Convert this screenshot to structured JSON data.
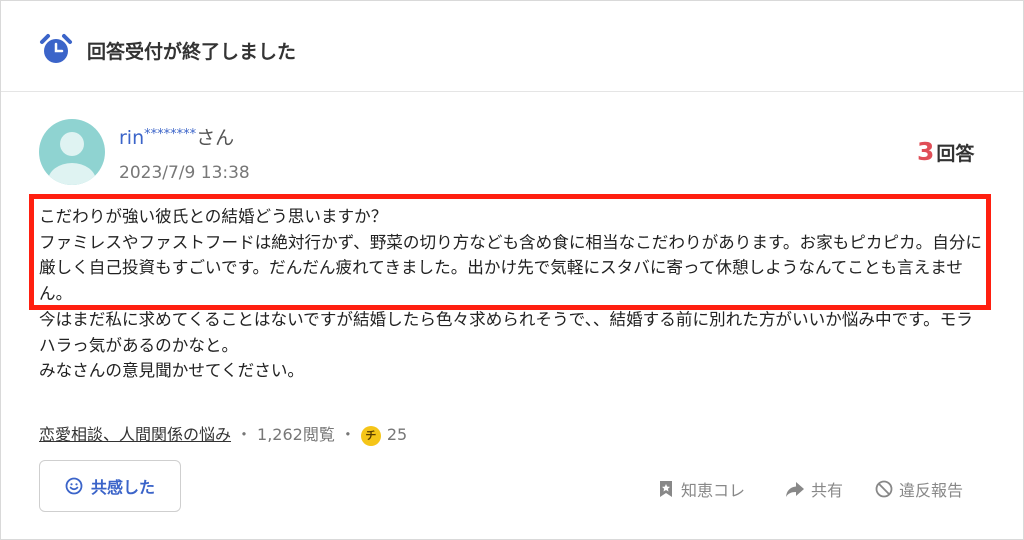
{
  "header": {
    "title": "回答受付が終了しました",
    "icon": "alarm-clock-icon"
  },
  "question": {
    "username": "rin",
    "username_mask": "********",
    "honorific": "さん",
    "posted_at": "2023/7/9 13:38",
    "answer_count": "3",
    "answer_label": "回答",
    "body_lines": [
      "こだわりが強い彼氏との結婚どう思いますか？",
      "ファミレスやファストフードは絶対行かず、野菜の切り方なども含め食に相当なこだわりがあります。お家もピカピカ。自分に厳しく自己投資もすごいです。だんだん疲れてきました。出かけ先で気軽にスタバに寄って休憩しようなんてことも言えません。",
      "今はまだ私に求めてくることはないですが結婚したら色々求められそうで、、結婚する前に別れた方がいいか悩み中です。モラハラっ気があるのかなと。",
      "みなさんの意見聞かせてください。"
    ]
  },
  "meta": {
    "category": "恋愛相談、人間関係の悩み",
    "separator": "・",
    "views": "1,262閲覧",
    "coin_symbol": "チ",
    "coins": "25"
  },
  "buttons": {
    "empathy": "共感した",
    "chie_kore": "知恵コレ",
    "share": "共有",
    "report": "違反報告"
  },
  "colors": {
    "accent_blue": "#3b64c9",
    "answer_count_red": "#e04e57",
    "highlight_red": "#ff1f10",
    "coin_yellow": "#f5c518",
    "avatar_teal": "#8fd3d1"
  }
}
